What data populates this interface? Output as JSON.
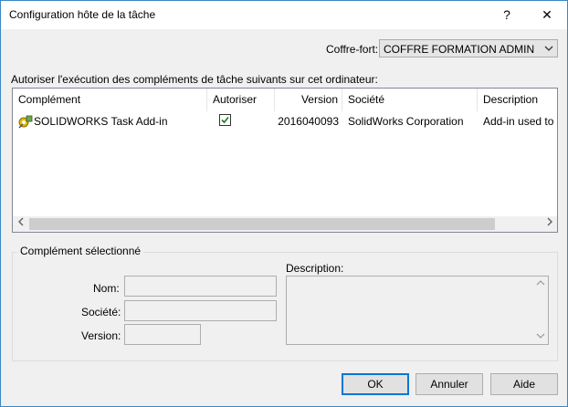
{
  "window": {
    "title": "Configuration hôte de la tâche",
    "help_label": "?",
    "close_label": "✕"
  },
  "vault": {
    "label": "Coffre-fort:",
    "selected": "COFFRE FORMATION ADMIN"
  },
  "instructions": "Autoriser l'exécution des compléments de tâche suivants sur cet ordinateur:",
  "table": {
    "columns": [
      "Complément",
      "Autoriser",
      "Version",
      "Société",
      "Description"
    ],
    "rows": [
      {
        "name": "SOLIDWORKS Task Add-in",
        "allowed": true,
        "version": "2016040093",
        "company": "SolidWorks Corporation",
        "description": "Add-in used to ru"
      }
    ]
  },
  "selected_addin": {
    "group_title": "Complément sélectionné",
    "name_label": "Nom:",
    "company_label": "Société:",
    "version_label": "Version:",
    "description_label": "Description:",
    "name_value": "",
    "company_value": "",
    "version_value": "",
    "description_value": ""
  },
  "buttons": {
    "ok": "OK",
    "cancel": "Annuler",
    "help": "Aide"
  },
  "colors": {
    "window_border": "#3a88c6",
    "default_button_border": "#0078d7",
    "icon_yellow": "#e6b800"
  }
}
